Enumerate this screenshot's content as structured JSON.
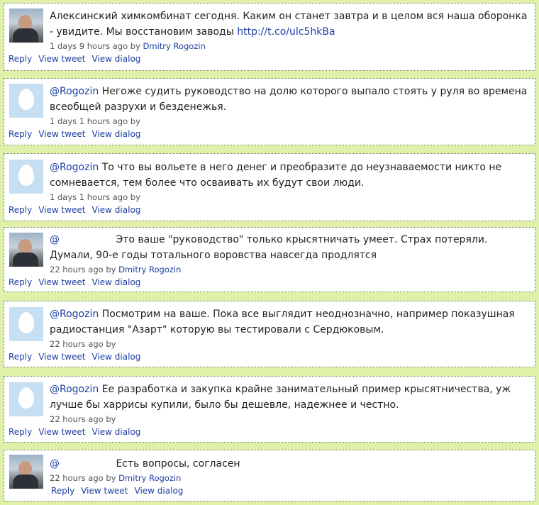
{
  "actions": {
    "reply": "Reply",
    "view_tweet": "View tweet",
    "view_dialog": "View dialog"
  },
  "tweets": [
    {
      "avatar": "rogozin-photo",
      "text": "Алексинский химкомбинат сегодня. Каким он станет завтра и в целом вся наша оборонка - увидите. Мы восстановим заводы",
      "link": "http://t.co/ulc5hkBa",
      "time": "1 days 9 hours ago by",
      "author": "Dmitry Rogozin"
    },
    {
      "avatar": "default-egg",
      "mention": "@Rogozin",
      "text": "Негоже судить руководство на долю которого выпало стоять у руля во времена всеобщей разрухи и безденежья.",
      "time": "1 days 1 hours ago by",
      "author": ""
    },
    {
      "avatar": "default-egg",
      "mention": "@Rogozin",
      "text": "То что вы вольете в него денег и преобразите до неузнаваемости никто не сомневается, тем более что осваивать их будут свои люди.",
      "time": "1 days 1 hours ago by",
      "author": ""
    },
    {
      "avatar": "rogozin-photo",
      "mention": "@",
      "text": "Это ваше \"руководство\" только крысятничать умеет. Страх потеряли. Думали, 90-е годы тотального воровства навсегда продлятся",
      "time": "22 hours ago by",
      "author": "Dmitry Rogozin"
    },
    {
      "avatar": "default-egg",
      "mention": "@Rogozin",
      "text": "Посмотрим на ваше. Пока все выглядит неоднозначно, например показушная радиостанция \"Азарт\" которую вы тестировали с Сердюковым.",
      "time": "22 hours ago by",
      "author": ""
    },
    {
      "avatar": "default-egg",
      "mention": "@Rogozin",
      "text": "Ее разработка и закупка крайне занимательный пример крысятничества, уж лучше бы харрисы купили, было бы дешевле, надежнее и честно.",
      "time": "22 hours ago by",
      "author": ""
    },
    {
      "avatar": "rogozin-photo",
      "mention": "@",
      "text": "Есть вопросы, согласен",
      "time": "22 hours ago by",
      "author": "Dmitry Rogozin"
    }
  ]
}
